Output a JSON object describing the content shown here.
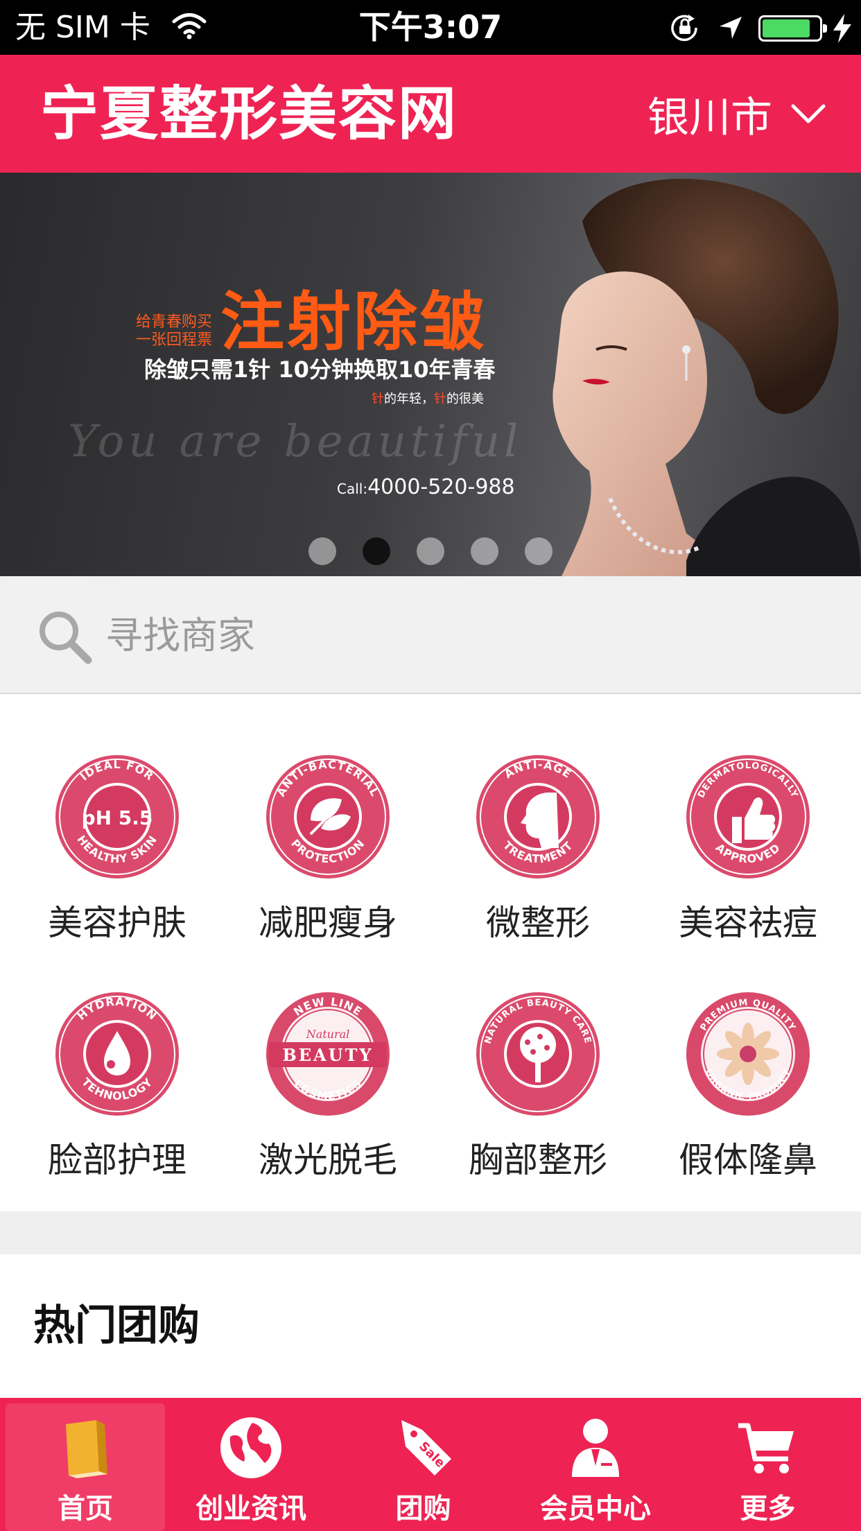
{
  "status_bar": {
    "carrier": "无 SIM 卡",
    "time": "下午3:07",
    "battery_level": 0.85
  },
  "header": {
    "title": "宁夏整形美容网",
    "city": "银川市"
  },
  "banner": {
    "lead_line1": "给青春购买",
    "lead_line2": "一张回程票",
    "headline": "注射除皱",
    "subline": "除皱只需1针 10分钟换取10年青春",
    "tagline_hl1": "针",
    "tagline_mid": "的年轻，",
    "tagline_hl2": "针",
    "tagline_end": "的很美",
    "script": "You are beautiful",
    "call_prefix": "Call:",
    "phone": "4000-520-988",
    "slide_count": 5,
    "active_slide": 2
  },
  "search": {
    "placeholder": "寻找商家"
  },
  "categories": [
    {
      "label": "美容护肤",
      "icon": "ph-balance-badge-icon",
      "badge_top": "IDEAL FOR",
      "badge_center": "pH 5.5",
      "badge_bottom": "HEALTHY SKIN"
    },
    {
      "label": "减肥瘦身",
      "icon": "leaf-badge-icon",
      "badge_top": "ANTI-BACTERIAL",
      "badge_bottom": "PROTECTION"
    },
    {
      "label": "微整形",
      "icon": "face-profile-badge-icon",
      "badge_top": "ANTI-AGE",
      "badge_bottom": "TREATMENT"
    },
    {
      "label": "美容祛痘",
      "icon": "thumbs-up-badge-icon",
      "badge_top": "DERMATOLOGICALLY",
      "badge_bottom": "APPROVED"
    },
    {
      "label": "脸部护理",
      "icon": "water-drop-badge-icon",
      "badge_top": "HYDRATION",
      "badge_bottom": "TEHNOLOGY"
    },
    {
      "label": "激光脱毛",
      "icon": "beauty-badge-icon",
      "badge_top": "NEW LINE",
      "badge_mid": "Natural",
      "badge_center": "BEAUTY",
      "badge_bottom": "COSMETICS"
    },
    {
      "label": "胸部整形",
      "icon": "tree-badge-icon",
      "badge_top": "NATURAL BEAUTY CARE"
    },
    {
      "label": "假体隆鼻",
      "icon": "flower-badge-icon",
      "badge_top": "PREMIUM QUALITY",
      "badge_bottom": "ORGANIC PRODUCT"
    }
  ],
  "section": {
    "title": "热门团购"
  },
  "tabbar": [
    {
      "label": "首页",
      "icon": "book-icon",
      "active": true
    },
    {
      "label": "创业资讯",
      "icon": "globe-icon",
      "active": false
    },
    {
      "label": "团购",
      "icon": "sale-tag-icon",
      "active": false
    },
    {
      "label": "会员中心",
      "icon": "user-icon",
      "active": false
    },
    {
      "label": "更多",
      "icon": "cart-icon",
      "active": false
    }
  ],
  "colors": {
    "brand": "#ee2353",
    "badge": "#d9496a",
    "badge_light": "#f2a0b3",
    "orange": "#ff5b14"
  }
}
